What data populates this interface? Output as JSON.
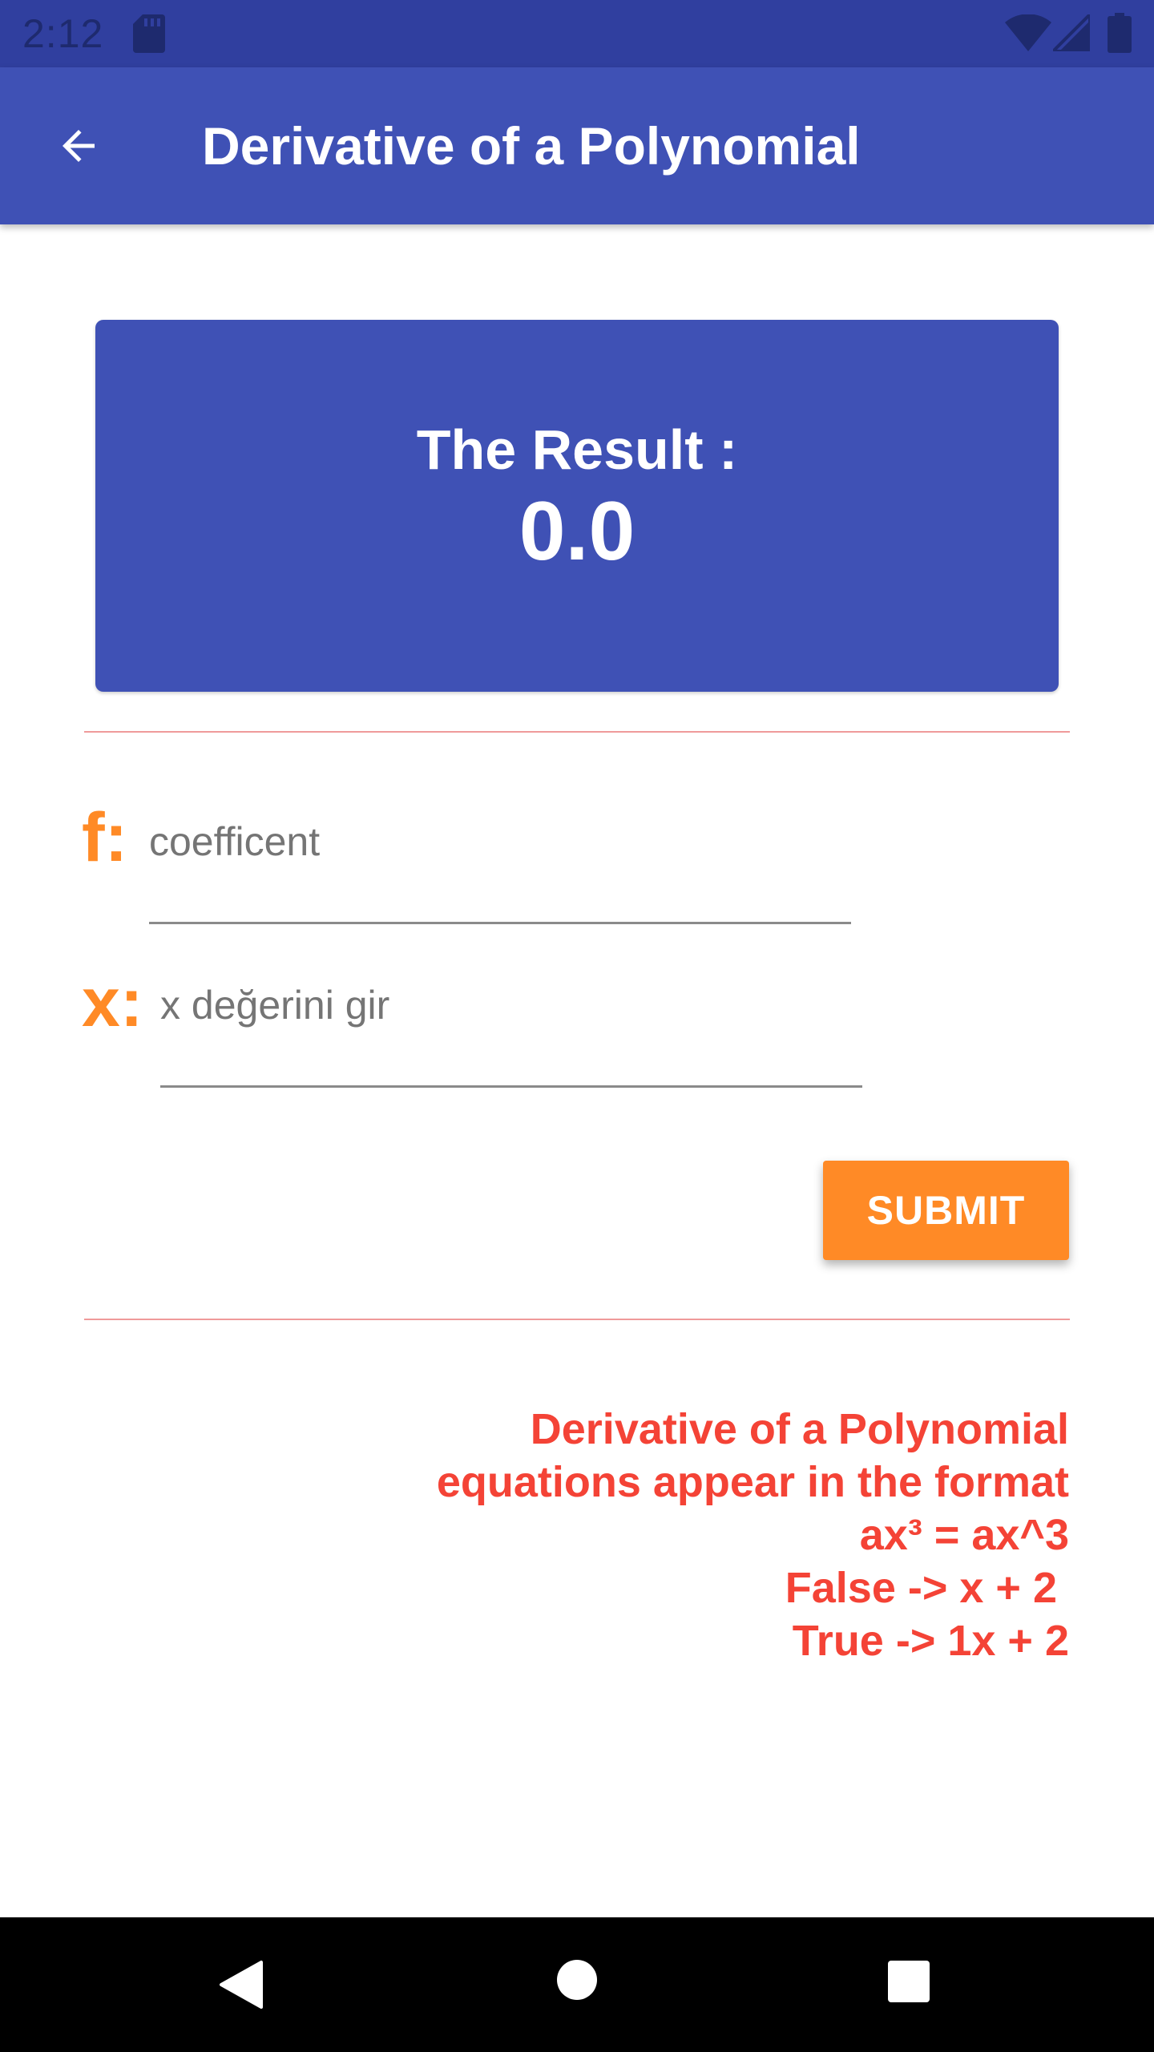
{
  "status_bar": {
    "time": "2:12",
    "icons": [
      "sd-card-icon",
      "wifi-icon",
      "signal-icon",
      "battery-icon"
    ]
  },
  "app_bar": {
    "title": "Derivative of a Polynomial",
    "back_icon": "arrow-back-icon"
  },
  "result": {
    "label": "The Result :",
    "value": "0.0"
  },
  "form": {
    "coefficient": {
      "prefix": "f:",
      "placeholder": "coefficent",
      "value": ""
    },
    "x_value": {
      "prefix": "x:",
      "placeholder": "x değerini gir",
      "value": ""
    },
    "submit_label": "SUBMIT"
  },
  "info": {
    "lines": [
      "Derivative of a Polynomial",
      "equations appear in the format",
      "ax³ = ax^3",
      "False -> x + 2 ",
      "True -> 1x + 2"
    ]
  },
  "nav_bar": {
    "icons": [
      "nav-back-icon",
      "nav-home-icon",
      "nav-recents-icon"
    ]
  },
  "colors": {
    "primary": "#3f51b5",
    "primary_dark": "#303f9f",
    "accent": "#ff8a26",
    "info_text": "#f44336",
    "divider": "#ef9a9a"
  }
}
